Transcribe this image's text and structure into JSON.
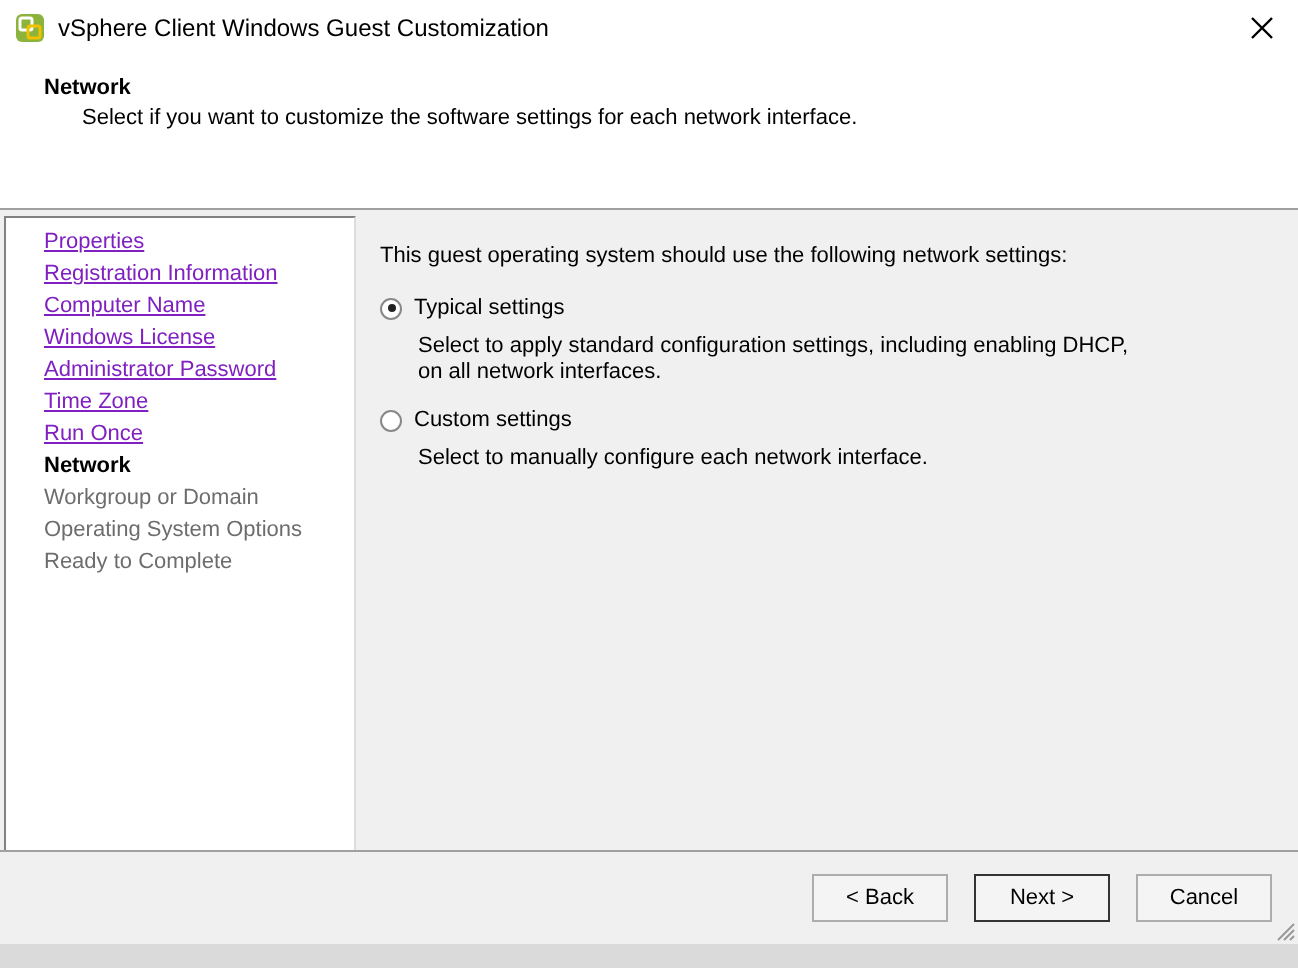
{
  "window": {
    "title": "vSphere Client Windows Guest Customization"
  },
  "header": {
    "title": "Network",
    "subtitle": "Select if you want to customize the software settings for each network interface."
  },
  "steps": [
    {
      "label": "Properties",
      "kind": "done"
    },
    {
      "label": "Registration Information",
      "kind": "done"
    },
    {
      "label": "Computer Name",
      "kind": "done"
    },
    {
      "label": "Windows License",
      "kind": "done"
    },
    {
      "label": "Administrator Password",
      "kind": "done"
    },
    {
      "label": "Time Zone",
      "kind": "done"
    },
    {
      "label": "Run Once",
      "kind": "done"
    },
    {
      "label": "Network",
      "kind": "current"
    },
    {
      "label": "Workgroup or Domain",
      "kind": "pending"
    },
    {
      "label": "Operating System Options",
      "kind": "pending"
    },
    {
      "label": "Ready to Complete",
      "kind": "pending"
    }
  ],
  "intro": "This guest operating system should use the following network settings:",
  "options": [
    {
      "label": "Typical settings",
      "selected": true,
      "description": "Select to apply standard configuration settings, including enabling DHCP, on all network interfaces."
    },
    {
      "label": "Custom settings",
      "selected": false,
      "description": "Select to manually configure each network interface."
    }
  ],
  "buttons": [
    {
      "label": "< Back",
      "default": false
    },
    {
      "label": "Next >",
      "default": true
    },
    {
      "label": "Cancel",
      "default": false
    }
  ]
}
